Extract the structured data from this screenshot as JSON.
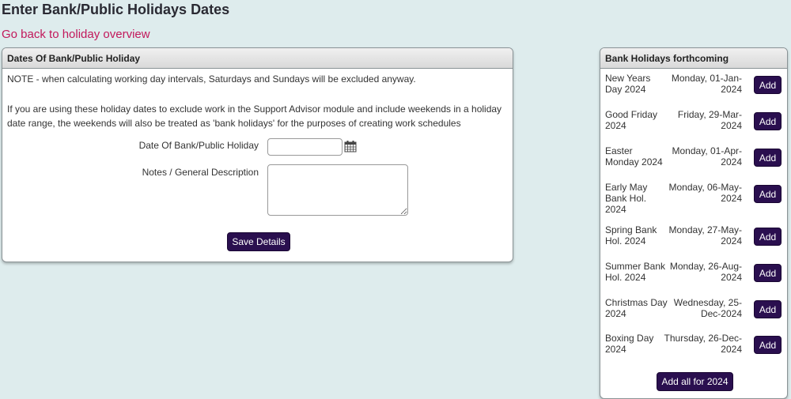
{
  "page": {
    "title": "Enter Bank/Public Holidays Dates",
    "back_link": "Go back to holiday overview"
  },
  "form_panel": {
    "header": "Dates Of Bank/Public Holiday",
    "note1": "NOTE - when calculating working day intervals, Saturdays and Sundays will be excluded anyway.",
    "note2": "If you are using these holiday dates to exclude work in the Support Advisor module and include weekends in a holiday date range, the weekends will also be treated as 'bank holidays' for the purposes of creating work schedules",
    "date_label": "Date Of Bank/Public Holiday",
    "date_value": "",
    "notes_label": "Notes / General Description",
    "notes_value": "",
    "save_label": "Save Details"
  },
  "forthcoming_panel": {
    "header": "Bank Holidays forthcoming",
    "add_label": "Add",
    "add_all_label": "Add all for 2024",
    "items": [
      {
        "name": "New Years Day 2024",
        "date": "Monday, 01-Jan-2024"
      },
      {
        "name": "Good Friday 2024",
        "date": "Friday, 29-Mar-2024"
      },
      {
        "name": "Easter Monday 2024",
        "date": "Monday, 01-Apr-2024"
      },
      {
        "name": "Early May Bank Hol. 2024",
        "date": "Monday, 06-May-2024"
      },
      {
        "name": "Spring Bank Hol. 2024",
        "date": "Monday, 27-May-2024"
      },
      {
        "name": "Summer Bank Hol. 2024",
        "date": "Monday, 26-Aug-2024"
      },
      {
        "name": "Christmas Day 2024",
        "date": "Wednesday, 25-Dec-2024"
      },
      {
        "name": "Boxing Day 2024",
        "date": "Thursday, 26-Dec-2024"
      }
    ]
  },
  "colors": {
    "background": "#deeced",
    "link": "#c2185b",
    "button": "#2a0f4f"
  }
}
